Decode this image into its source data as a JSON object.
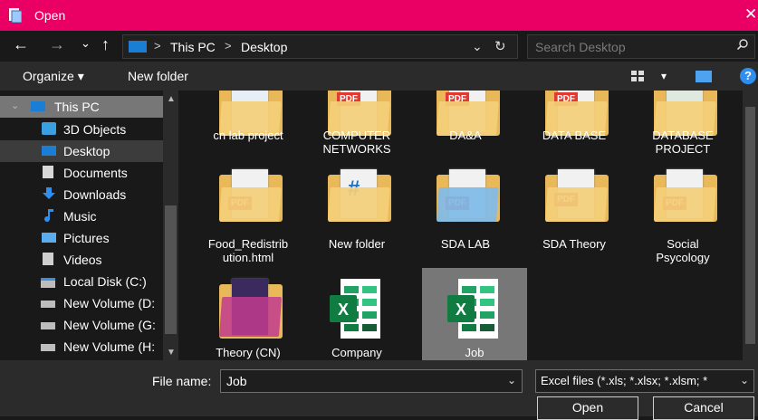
{
  "window": {
    "title": "Open",
    "close_glyph": "✕"
  },
  "nav": {
    "back_glyph": "←",
    "forward_glyph": "→",
    "recent_glyph": "⌄",
    "up_glyph": "↑",
    "breadcrumb": [
      "This PC",
      "Desktop"
    ],
    "sep_glyph": ">",
    "dropdown_glyph": "⌄",
    "refresh_glyph": "↻",
    "search_placeholder": "Search Desktop"
  },
  "toolbar": {
    "organize": "Organize ▾",
    "new_folder": "New folder",
    "help": "?",
    "view_dd": "▾"
  },
  "sidebar": {
    "items": [
      {
        "label": "This PC",
        "icon": "pc-icon"
      },
      {
        "label": "3D Objects",
        "icon": "cube-icon"
      },
      {
        "label": "Desktop",
        "icon": "desktop-icon"
      },
      {
        "label": "Documents",
        "icon": "documents-icon"
      },
      {
        "label": "Downloads",
        "icon": "download-icon"
      },
      {
        "label": "Music",
        "icon": "music-icon"
      },
      {
        "label": "Pictures",
        "icon": "pictures-icon"
      },
      {
        "label": "Videos",
        "icon": "videos-icon"
      },
      {
        "label": "Local Disk (C:)",
        "icon": "drive-icon"
      },
      {
        "label": "New Volume (D:",
        "icon": "drive-icon"
      },
      {
        "label": "New Volume (G:",
        "icon": "drive-icon"
      },
      {
        "label": "New Volume (H:",
        "icon": "drive-icon"
      }
    ]
  },
  "files": [
    {
      "l1": "cn lab project",
      "l2": ""
    },
    {
      "l1": "COMPUTER",
      "l2": "NETWORKS"
    },
    {
      "l1": "DA&A",
      "l2": ""
    },
    {
      "l1": "DATA BASE",
      "l2": ""
    },
    {
      "l1": "DATABASE",
      "l2": "PROJECT"
    },
    {
      "l1": "Food_Redistrib",
      "l2": "ution.html"
    },
    {
      "l1": "New folder",
      "l2": ""
    },
    {
      "l1": "SDA LAB",
      "l2": ""
    },
    {
      "l1": "SDA Theory",
      "l2": ""
    },
    {
      "l1": "Social",
      "l2": "Psycology"
    },
    {
      "l1": "Theory (CN)",
      "l2": ""
    },
    {
      "l1": "Company",
      "l2": ""
    },
    {
      "l1": "Job",
      "l2": ""
    }
  ],
  "glyphs": {
    "pdf": "PDF",
    "hash": "#",
    "excel_x": "X"
  },
  "footer": {
    "file_name_label": "File name:",
    "file_name_value": "Job",
    "filter_value": "Excel files (*.xls; *.xlsx; *.xlsm; *",
    "open_label": "Open",
    "cancel_label": "Cancel",
    "dd_glyph": "⌄"
  },
  "colors": {
    "titlebar": "#ea0064",
    "selection": "#777777",
    "folder": "#e9b959"
  }
}
